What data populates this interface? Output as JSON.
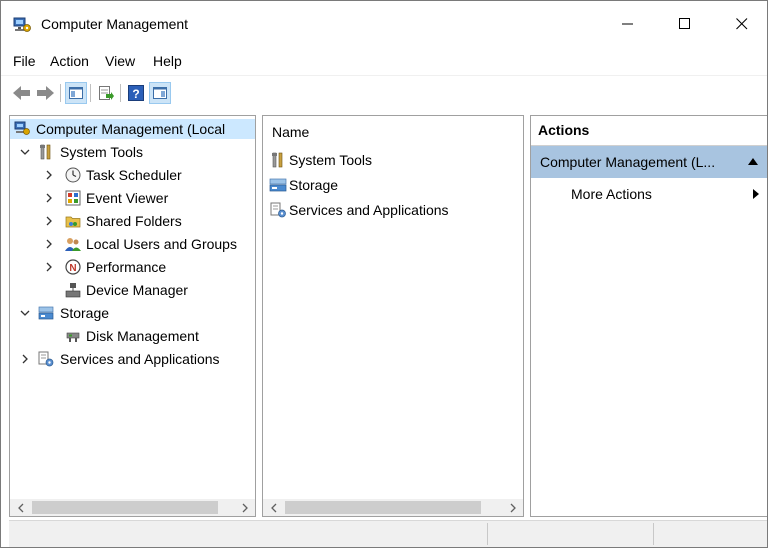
{
  "window": {
    "title": "Computer Management"
  },
  "menubar": {
    "items": [
      "File",
      "Action",
      "View",
      "Help"
    ]
  },
  "tree": {
    "items": [
      {
        "label": "Computer Management (Local"
      },
      {
        "label": "System Tools"
      },
      {
        "label": "Task Scheduler"
      },
      {
        "label": "Event Viewer"
      },
      {
        "label": "Shared Folders"
      },
      {
        "label": "Local Users and Groups"
      },
      {
        "label": "Performance"
      },
      {
        "label": "Device Manager"
      },
      {
        "label": "Storage"
      },
      {
        "label": "Disk Management"
      },
      {
        "label": "Services and Applications"
      }
    ]
  },
  "list": {
    "header": "Name",
    "items": [
      {
        "label": "System Tools"
      },
      {
        "label": "Storage"
      },
      {
        "label": "Services and Applications"
      }
    ]
  },
  "actions": {
    "header": "Actions",
    "group_label": "Computer Management (L...",
    "item_label": "More Actions"
  },
  "colors": {
    "selection": "#cce8ff",
    "actions_group": "#a8c4e0",
    "toolbar_toggled": "#cce4f7"
  }
}
